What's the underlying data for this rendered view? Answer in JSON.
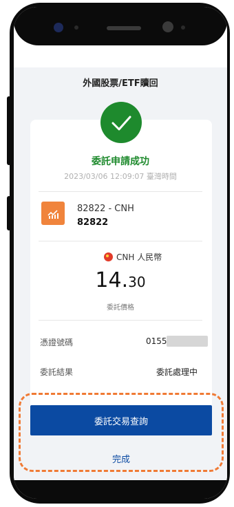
{
  "header": {
    "title": "外國股票/ETF贖回"
  },
  "result": {
    "status": "委託申請成功",
    "datetime": "2023/03/06 12:09:07 臺灣時間"
  },
  "stock": {
    "name": "82822 - CNH",
    "code": "82822",
    "icon": "chart-icon"
  },
  "price": {
    "currency": "CNH 人民幣",
    "int": "14.",
    "dec": "30",
    "label": "委託價格"
  },
  "details": [
    {
      "label": "憑證號碼",
      "value": "0155"
    },
    {
      "label": "委託結果",
      "value": "委託處理中"
    }
  ],
  "actions": {
    "query_label": "委託交易查詢",
    "done_label": "完成"
  },
  "colors": {
    "success": "#1e8a2d",
    "primary": "#0b4aa2",
    "accent": "#f0843c",
    "highlight": "#f07a34"
  }
}
